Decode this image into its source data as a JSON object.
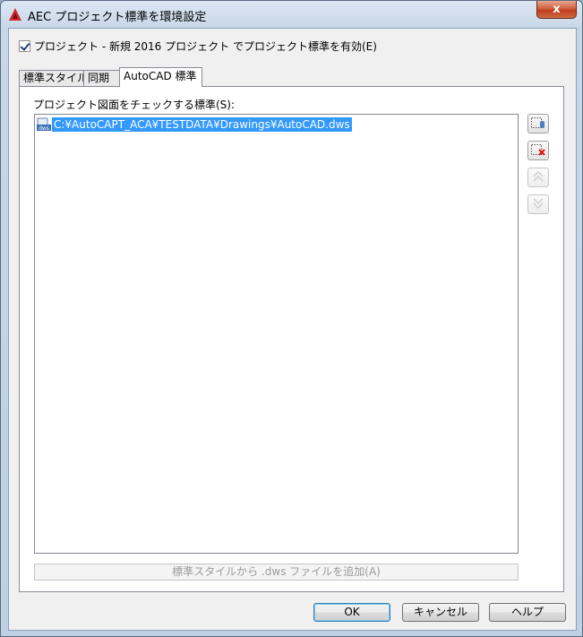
{
  "window": {
    "title": "AEC プロジェクト標準を環境設定",
    "close_glyph": "x"
  },
  "enable_checkbox": {
    "label": "プロジェクト  - 新規 2016 プロジェクト でプロジェクト標準を有効(E)",
    "checked": true
  },
  "tabs": [
    {
      "label": "標準スタイル",
      "active": false
    },
    {
      "label": "同期",
      "active": false
    },
    {
      "label": "AutoCAD 標準",
      "active": true
    }
  ],
  "panel": {
    "list_label": "プロジェクト図面をチェックする標準(S):",
    "items": [
      {
        "icon": "dws-file-icon",
        "icon_text": "dws",
        "path": "C:¥AutoCAPT_ACA¥TESTDATA¥Drawings¥AutoCAD.dws",
        "selected": true
      }
    ],
    "add_from_styles_button": "標準スタイルから .dws ファイルを追加(A)",
    "side_buttons": [
      {
        "name": "add-standards-file-button",
        "icon": "add-file-icon",
        "enabled": true
      },
      {
        "name": "remove-standards-file-button",
        "icon": "remove-file-icon",
        "enabled": true
      },
      {
        "name": "move-up-button",
        "icon": "move-up-icon",
        "enabled": false
      },
      {
        "name": "move-down-button",
        "icon": "move-down-icon",
        "enabled": false
      }
    ]
  },
  "footer": {
    "ok": "OK",
    "cancel": "キャンセル",
    "help": "ヘルプ"
  },
  "colors": {
    "selection": "#3399ff",
    "title_icon": "#d42a2a"
  }
}
